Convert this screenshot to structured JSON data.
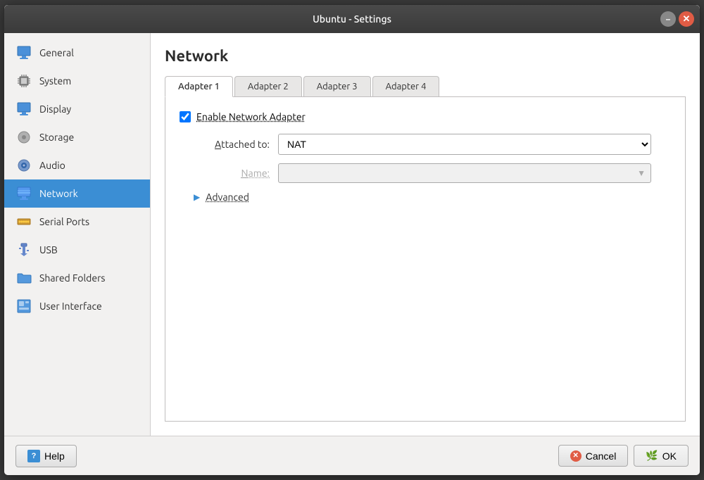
{
  "window": {
    "title": "Ubuntu - Settings",
    "minimize_label": "–",
    "close_label": "✕"
  },
  "sidebar": {
    "items": [
      {
        "id": "general",
        "label": "General",
        "icon": "monitor-icon"
      },
      {
        "id": "system",
        "label": "System",
        "icon": "cpu-icon"
      },
      {
        "id": "display",
        "label": "Display",
        "icon": "display-icon"
      },
      {
        "id": "storage",
        "label": "Storage",
        "icon": "storage-icon"
      },
      {
        "id": "audio",
        "label": "Audio",
        "icon": "audio-icon"
      },
      {
        "id": "network",
        "label": "Network",
        "icon": "network-icon"
      },
      {
        "id": "serial-ports",
        "label": "Serial Ports",
        "icon": "serial-icon"
      },
      {
        "id": "usb",
        "label": "USB",
        "icon": "usb-icon"
      },
      {
        "id": "shared-folders",
        "label": "Shared Folders",
        "icon": "folder-icon"
      },
      {
        "id": "user-interface",
        "label": "User Interface",
        "icon": "ui-icon"
      }
    ]
  },
  "main": {
    "page_title": "Network",
    "tabs": [
      {
        "id": "adapter1",
        "label": "Adapter 1",
        "active": true
      },
      {
        "id": "adapter2",
        "label": "Adapter 2",
        "active": false
      },
      {
        "id": "adapter3",
        "label": "Adapter 3",
        "active": false
      },
      {
        "id": "adapter4",
        "label": "Adapter 4",
        "active": false
      }
    ],
    "enable_label": "Enable Network Adapter",
    "attached_to_label": "Attached to:",
    "attached_to_value": "NAT",
    "name_label": "Name:",
    "name_placeholder": "",
    "advanced_label": "Advanced"
  },
  "footer": {
    "help_label": "Help",
    "cancel_label": "Cancel",
    "ok_label": "OK"
  }
}
